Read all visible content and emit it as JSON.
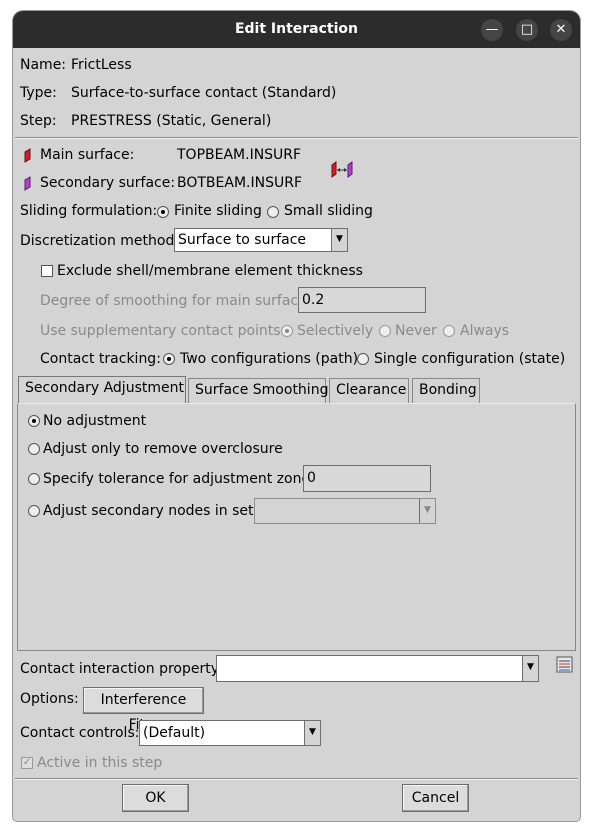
{
  "window": {
    "title": "Edit Interaction",
    "minimize_glyph": "—",
    "maximize_glyph": "□",
    "close_glyph": "✕"
  },
  "info": {
    "name_label": "Name:",
    "name_value": "FrictLess",
    "type_label": "Type:",
    "type_value": "Surface-to-surface contact (Standard)",
    "step_label": "Step:",
    "step_value": "PRESTRESS (Static, General)"
  },
  "surfaces": {
    "main_label": "Main surface:",
    "main_value": "TOPBEAM.INSURF",
    "secondary_label": "Secondary surface:",
    "secondary_value": "BOTBEAM.INSURF",
    "swap_icon": "swap-surfaces-icon",
    "main_color": "#d0202a",
    "secondary_color": "#b53fc8"
  },
  "sliding": {
    "label": "Sliding formulation:",
    "options": [
      "Finite sliding",
      "Small sliding"
    ],
    "selected": "Finite sliding"
  },
  "discretization": {
    "label": "Discretization method:",
    "value": "Surface to surface"
  },
  "exclude_thickness": {
    "label": "Exclude shell/membrane element thickness",
    "checked": false
  },
  "smoothing": {
    "label": "Degree of smoothing for main surface:",
    "value": "0.2"
  },
  "supplementary": {
    "label": "Use supplementary contact points:",
    "options": [
      "Selectively",
      "Never",
      "Always"
    ],
    "selected": "Selectively"
  },
  "tracking": {
    "label": "Contact tracking:",
    "options": [
      "Two configurations (path)",
      "Single configuration (state)"
    ],
    "selected": "Two configurations (path)"
  },
  "tabs": [
    "Secondary Adjustment",
    "Surface Smoothing",
    "Clearance",
    "Bonding"
  ],
  "adjustment": {
    "options": [
      "No adjustment",
      "Adjust only to remove overclosure",
      "Specify tolerance for adjustment zone:",
      "Adjust secondary nodes in set:"
    ],
    "selected": "No adjustment",
    "tolerance_value": "0",
    "node_set_value": ""
  },
  "property": {
    "label": "Contact interaction property:",
    "value": "",
    "create_icon": "create-property-icon"
  },
  "options": {
    "label": "Options:",
    "button": "Interference Fit..."
  },
  "controls": {
    "label": "Contact controls:",
    "value": "(Default)"
  },
  "active": {
    "label": "Active in this step",
    "checked": true
  },
  "footer": {
    "ok": "OK",
    "cancel": "Cancel"
  }
}
